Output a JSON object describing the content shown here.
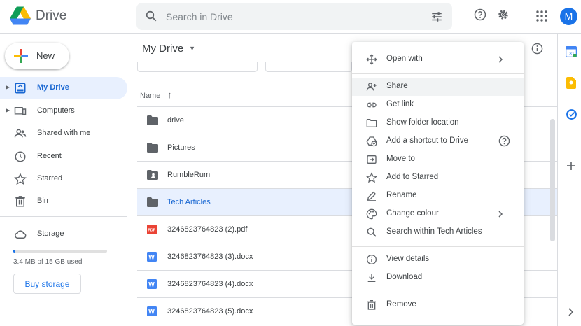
{
  "app": {
    "name": "Drive",
    "avatar_initial": "M"
  },
  "search": {
    "placeholder": "Search in Drive"
  },
  "sidebar": {
    "new_label": "New",
    "items": [
      {
        "label": "My Drive",
        "icon": "my-drive-icon",
        "active": true
      },
      {
        "label": "Computers",
        "icon": "computers-icon"
      },
      {
        "label": "Shared with me",
        "icon": "shared-icon"
      },
      {
        "label": "Recent",
        "icon": "clock-icon"
      },
      {
        "label": "Starred",
        "icon": "star-icon"
      },
      {
        "label": "Bin",
        "icon": "bin-icon"
      }
    ],
    "storage_label": "Storage",
    "storage_text": "3.4 MB of 15 GB used",
    "storage_used_fraction": 0.02,
    "buy_label": "Buy storage"
  },
  "main": {
    "title": "My Drive",
    "column_name": "Name",
    "files": [
      {
        "name": "drive",
        "type": "folder"
      },
      {
        "name": "Pictures",
        "type": "folder"
      },
      {
        "name": "RumbleRum",
        "type": "shared-folder"
      },
      {
        "name": "Tech Articles",
        "type": "folder",
        "selected": true
      },
      {
        "name": "3246823764823 (2).pdf",
        "type": "pdf"
      },
      {
        "name": "3246823764823 (3).docx",
        "type": "docx"
      },
      {
        "name": "3246823764823 (4).docx",
        "type": "docx"
      },
      {
        "name": "3246823764823 (5).docx",
        "type": "docx"
      }
    ]
  },
  "context_menu": {
    "items": [
      {
        "label": "Open with",
        "icon": "open-with-icon",
        "submenu": true
      },
      {
        "label": "Share",
        "icon": "share-person-icon",
        "hover": true
      },
      {
        "label": "Get link",
        "icon": "link-icon"
      },
      {
        "label": "Show folder location",
        "icon": "folder-outline-icon"
      },
      {
        "label": "Add a shortcut to Drive",
        "icon": "add-shortcut-icon",
        "help": true
      },
      {
        "label": "Move to",
        "icon": "move-to-icon"
      },
      {
        "label": "Add to Starred",
        "icon": "star-outline-icon"
      },
      {
        "label": "Rename",
        "icon": "pencil-icon"
      },
      {
        "label": "Change colour",
        "icon": "palette-icon",
        "submenu": true
      },
      {
        "label": "Search within Tech Articles",
        "icon": "search-icon"
      },
      {
        "label": "View details",
        "icon": "info-icon"
      },
      {
        "label": "Download",
        "icon": "download-icon"
      },
      {
        "label": "Remove",
        "icon": "bin-icon"
      }
    ]
  },
  "colors": {
    "accent": "#1a73e8",
    "selected_bg": "#e8f0fe",
    "folder": "#5f6368",
    "pdf": "#ea4335",
    "docx": "#4285f4"
  }
}
